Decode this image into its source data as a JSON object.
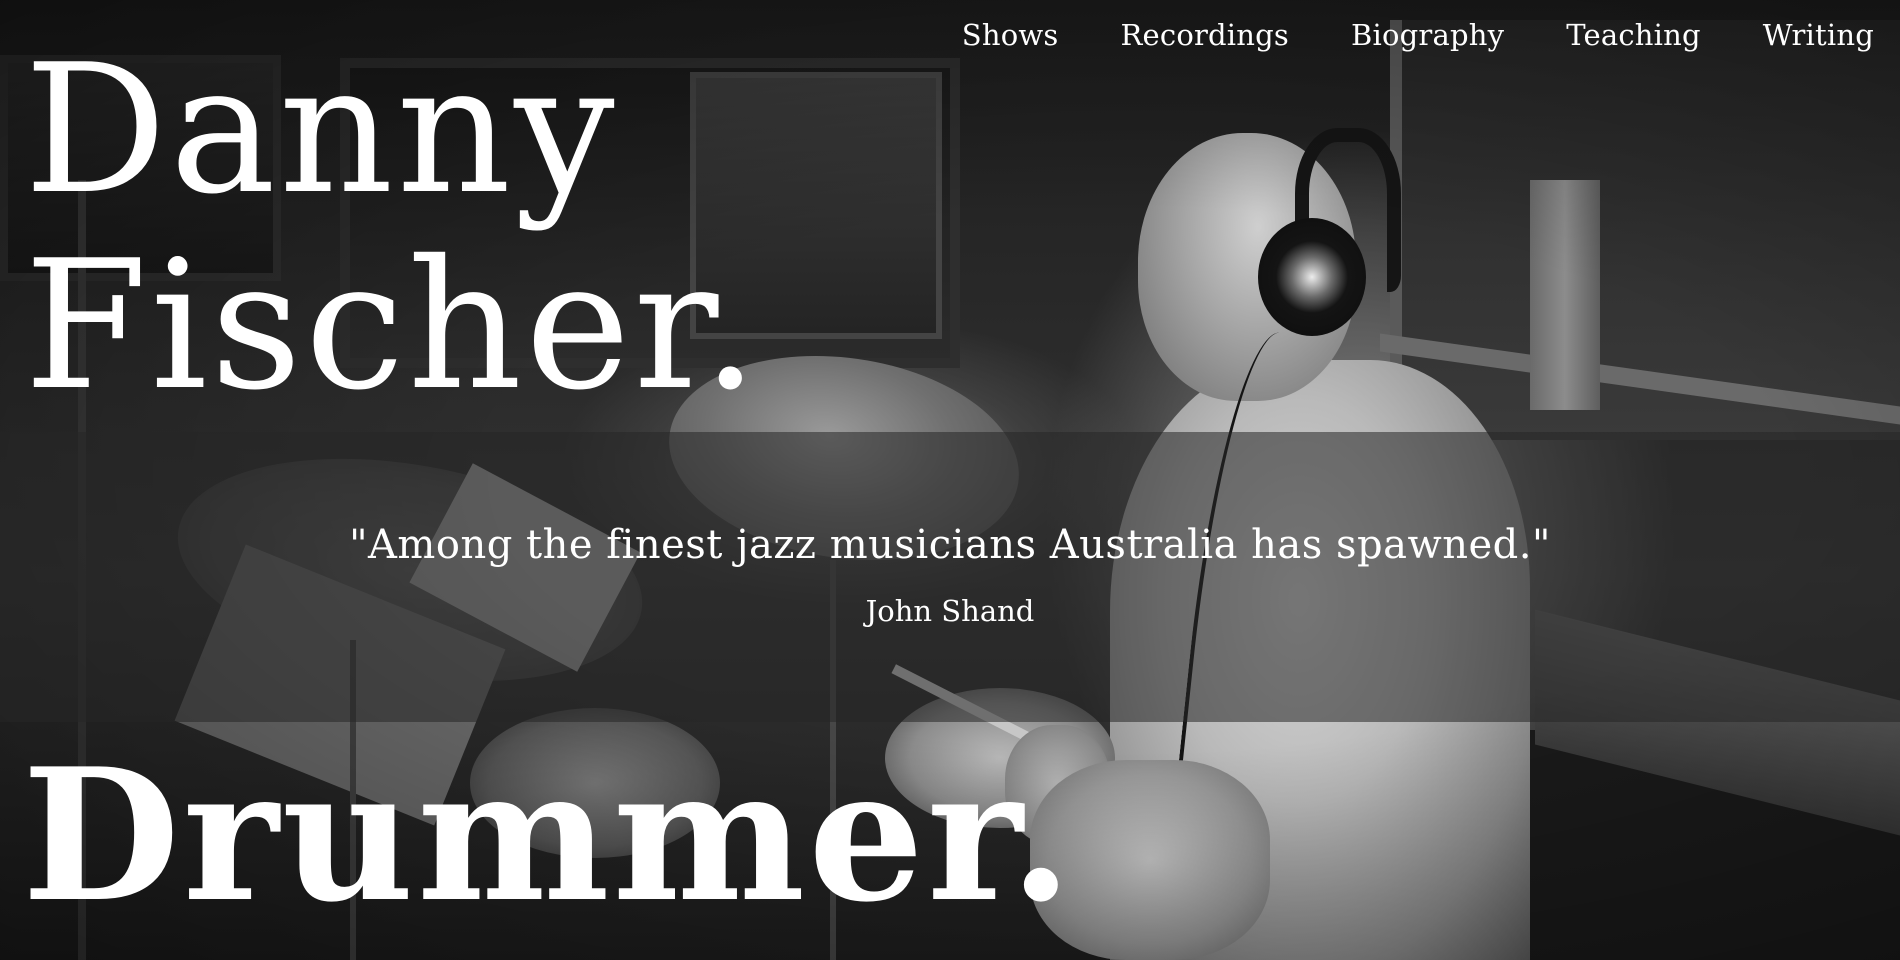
{
  "nav": {
    "items": [
      {
        "label": "Shows"
      },
      {
        "label": "Recordings"
      },
      {
        "label": "Biography"
      },
      {
        "label": "Teaching"
      },
      {
        "label": "Writing"
      }
    ]
  },
  "hero": {
    "name_line1": "Danny",
    "name_line2": "Fischer.",
    "role": "Drummer.",
    "background_image": "grayscale studio photo of drummer wearing headphones"
  },
  "quote": {
    "text": "\"Among the finest jazz musicians Australia has spawned.\"",
    "author": "John Shand"
  },
  "colors": {
    "text": "#ffffff",
    "band_overlay": "rgba(38,38,38,0.55)"
  }
}
